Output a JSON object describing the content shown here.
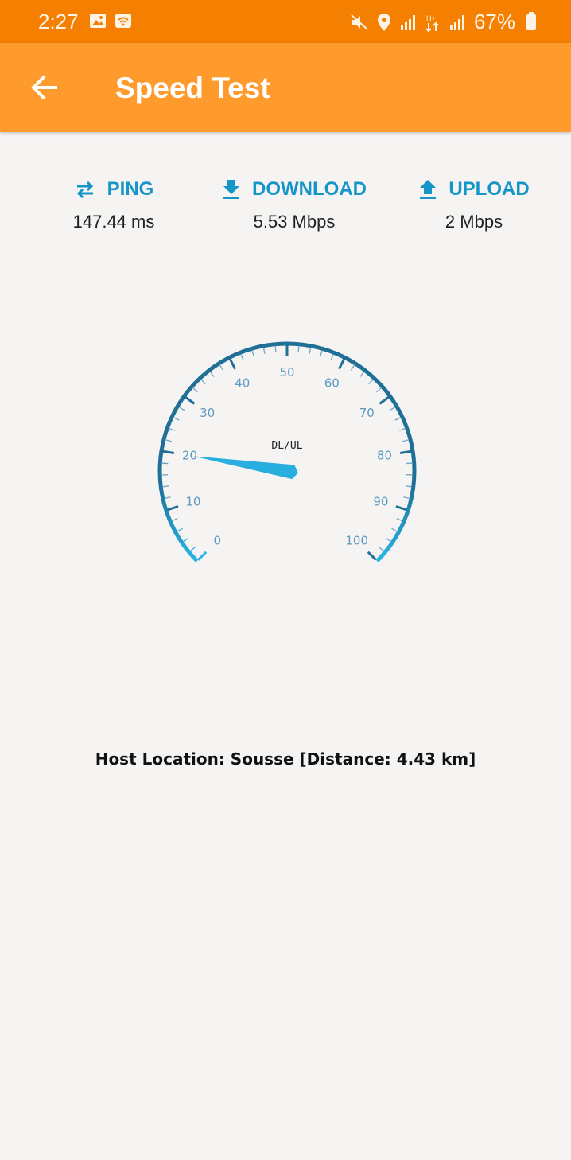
{
  "status_bar": {
    "time": "2:27",
    "battery": "67%",
    "icons": [
      "image-icon",
      "wifi-icon",
      "mute-icon",
      "location-icon",
      "signal-icon",
      "data-icon",
      "signal-icon",
      "battery-icon"
    ]
  },
  "app_bar": {
    "title": "Speed Test",
    "back_icon": "arrow-left-icon"
  },
  "metrics": {
    "ping": {
      "label": "PING",
      "value": "147.44 ms",
      "icon": "swap-arrows-icon"
    },
    "download": {
      "label": "DOWNLOAD",
      "value": "5.53 Mbps",
      "icon": "download-icon"
    },
    "upload": {
      "label": "UPLOAD",
      "value": "2 Mbps",
      "icon": "upload-icon"
    }
  },
  "gauge": {
    "label": "DL/UL",
    "ticks": [
      "0",
      "10",
      "20",
      "30",
      "40",
      "50",
      "60",
      "70",
      "80",
      "90",
      "100"
    ],
    "value": 20,
    "colors": {
      "arc": "#1f6f96",
      "needle": "#29aee0",
      "label": "#5c9bc0"
    }
  },
  "host": {
    "text": "Host Location: Sousse [Distance: 4.43 km]"
  }
}
